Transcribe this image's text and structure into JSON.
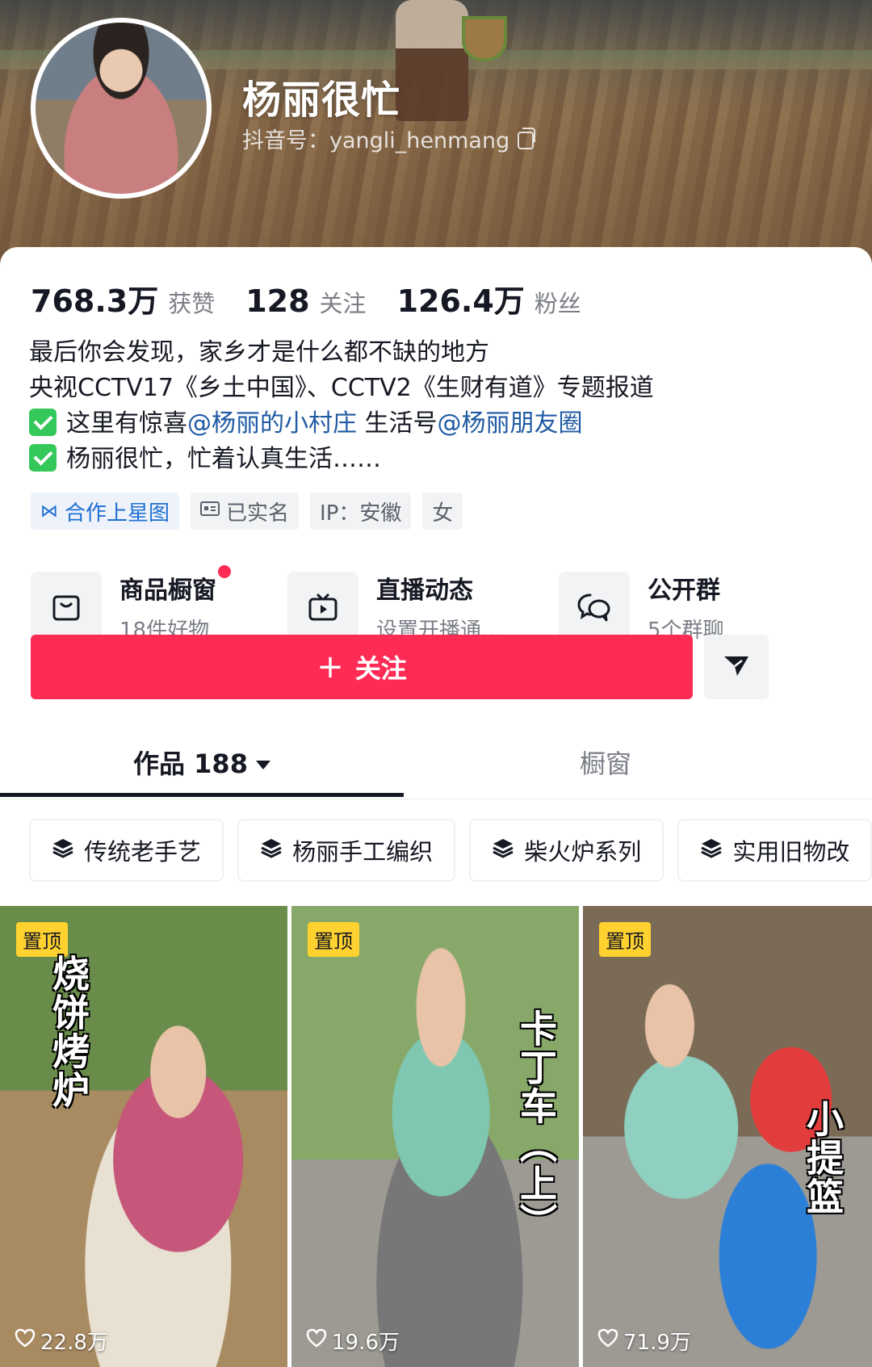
{
  "profile": {
    "nickname": "杨丽很忙",
    "douyin_id": "抖音号：yangli_henmang"
  },
  "stats": [
    {
      "num": "768.3万",
      "label": "获赞"
    },
    {
      "num": "128",
      "label": "关注"
    },
    {
      "num": "126.4万",
      "label": "粉丝"
    }
  ],
  "bio": {
    "line1": "最后你会发现，家乡才是什么都不缺的地方",
    "line2": "央视CCTV17《乡土中国》、CCTV2《生财有道》专题报道",
    "line3_prefix": "这里有惊喜",
    "line3_link1": "@杨丽的小村庄",
    "line3_mid": " 生活号",
    "line3_link2": "@杨丽朋友圈",
    "line4": "杨丽很忙，忙着认真生活……"
  },
  "tags": {
    "star": "合作上星图",
    "verified": "已实名",
    "ip": "IP：安徽",
    "gender": "女"
  },
  "features": [
    {
      "title": "商品橱窗",
      "sub": "18件好物",
      "icon": "bag-icon"
    },
    {
      "title": "直播动态",
      "sub": "设置开播通…",
      "icon": "tv-icon"
    },
    {
      "title": "公开群",
      "sub": "5个群聊",
      "icon": "chat-icon"
    }
  ],
  "actions": {
    "follow": "关注"
  },
  "tabs": {
    "works": "作品 188",
    "showcase": "橱窗"
  },
  "collections": [
    "传统老手艺",
    "杨丽手工编织",
    "柴火炉系列",
    "实用旧物改"
  ],
  "videos": [
    {
      "pin": "置顶",
      "title": "烧饼烤炉",
      "likes": "22.8万"
    },
    {
      "pin": "置顶",
      "title": "卡丁车（上）",
      "likes": "19.6万"
    },
    {
      "pin": "置顶",
      "title": "小提篮",
      "likes": "71.9万"
    }
  ],
  "colors": {
    "accent": "#fe2c55",
    "link": "#1f5aa3",
    "pin": "#ffd230",
    "check": "#34c759"
  }
}
